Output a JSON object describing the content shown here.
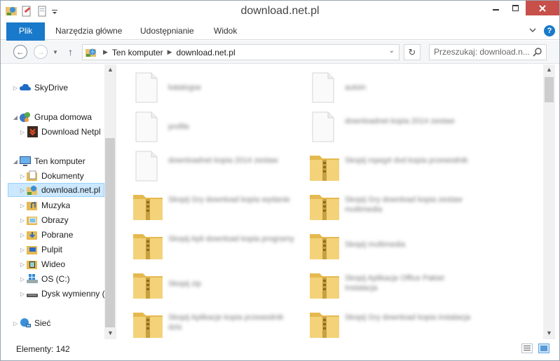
{
  "window": {
    "title": "download.net.pl"
  },
  "ribbon": {
    "tabs": [
      "Plik",
      "Narzędzia główne",
      "Udostępnianie",
      "Widok"
    ]
  },
  "address": {
    "crumbs": [
      "Ten komputer",
      "download.net.pl"
    ],
    "search_placeholder": "Przeszukaj: download.n..."
  },
  "nav": {
    "skydrive": "SkyDrive",
    "homegroup": "Grupa domowa",
    "homegroup_child": "Download Netpl",
    "computer": "Ten komputer",
    "documents": "Dokumenty",
    "downloadnet": "download.net.pl",
    "music": "Muzyka",
    "pictures": "Obrazy",
    "downloads": "Pobrane",
    "desktop": "Pulpit",
    "videos": "Wideo",
    "osdrive": "OS (C:)",
    "removable": "Dysk wymienny (",
    "network": "Sieć"
  },
  "files": [
    {
      "name": "katalogse",
      "type": "document"
    },
    {
      "name": "autoin",
      "type": "document"
    },
    {
      "name": "profile",
      "type": "document"
    },
    {
      "name": "downloadnet kopia 2014 zestaw",
      "type": "document"
    },
    {
      "name": "downloadnet kopia 2014 zestaw",
      "type": "document"
    },
    {
      "name": "Skopij mpeg4 dvd kopia przewodnik",
      "type": "zip"
    },
    {
      "name": "Skopij Gry download kopia wydanie",
      "type": "zip"
    },
    {
      "name": "Skopij Gry download kopia zestaw multimedia",
      "type": "zip"
    },
    {
      "name": "Skopij Apli download kopia programy",
      "type": "zip"
    },
    {
      "name": "Skopij multimedia",
      "type": "zip"
    },
    {
      "name": "Skopij zip",
      "type": "zip"
    },
    {
      "name": "Skopij Aplikacje Office Pakiet Instalacja",
      "type": "zip"
    },
    {
      "name": "Skopij Aplikacje kopia przewodnik dzis",
      "type": "zip"
    },
    {
      "name": "Skopij Gry download kopia instalacja",
      "type": "zip"
    }
  ],
  "status": {
    "count": "Elementy: 142"
  },
  "colors": {
    "accent": "#1979ca",
    "close": "#c7504a",
    "selection": "#cce8ff"
  }
}
